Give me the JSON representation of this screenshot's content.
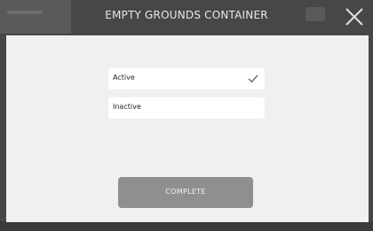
{
  "modal": {
    "title": "EMPTY GROUNDS CONTAINER",
    "close_icon": "close-icon"
  },
  "options": [
    {
      "label": "Active",
      "selected": true,
      "icon": "checkmark-icon"
    },
    {
      "label": "Inactive",
      "selected": false
    }
  ],
  "actions": {
    "complete_label": "COMPLETE"
  },
  "colors": {
    "overlay": "#474747",
    "panel": "#f0f0f0",
    "option_bg": "#ffffff",
    "button_bg": "#8f8f8f",
    "title_text": "#e8e8e8"
  }
}
